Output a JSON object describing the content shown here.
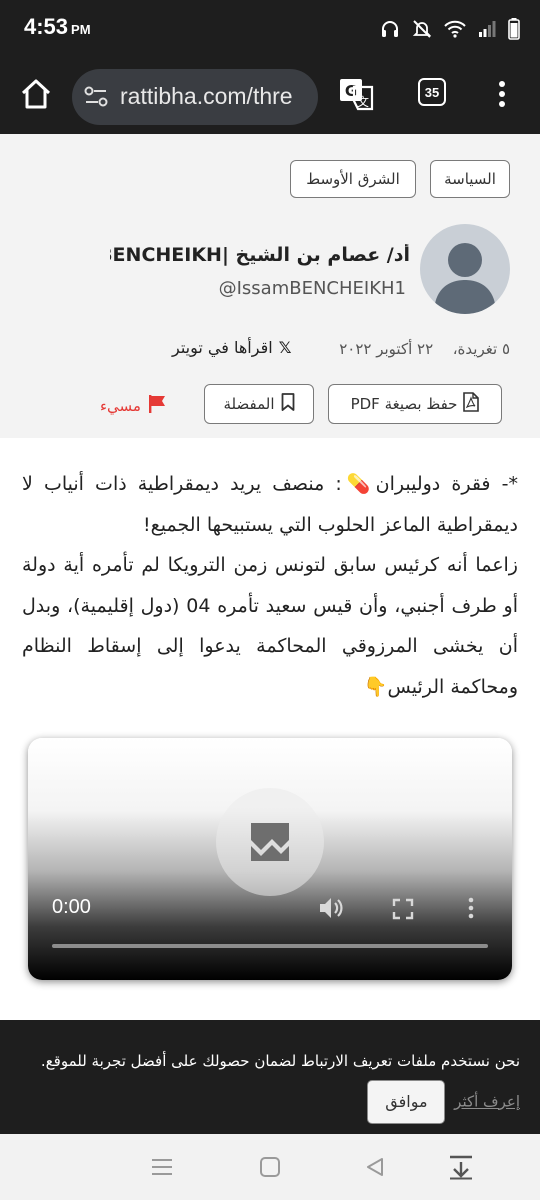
{
  "status_bar": {
    "time": "4:53",
    "ampm": "PM",
    "icons": [
      "headphones-icon",
      "mute-icon",
      "wifi-icon",
      "signal-icon",
      "battery-icon"
    ]
  },
  "browser": {
    "url": "rattibha.com/thre",
    "tab_count": "35",
    "icons": [
      "home-icon",
      "site-settings-icon",
      "translate-icon",
      "tabs-icon",
      "more-menu-icon"
    ]
  },
  "tags": [
    "السياسة",
    "الشرق الأوسط"
  ],
  "author": {
    "name": "أد/ عصام بن الشيخ |BENCHEIKH...",
    "handle": "@IssamBENCHEIKH1"
  },
  "meta": {
    "tweet_count": "٥ تغريدة،",
    "date": "٢٢ أكتوبر ٢٠٢٢",
    "read_on_x": "اقرأها في تويتر",
    "x_logo": "𝕏"
  },
  "actions": {
    "save_pdf": "حفظ بصيغة PDF",
    "favorites": "المفضلة",
    "report": "مسيء"
  },
  "article": {
    "text": "*- فقرة دوليبران💊: منصف يريد ديمقراطية ذات أنياب لا ديمقراطية الماعز الحلوب التي يستبيحها الجميع!\nزاعما أنه كرئيس سابق لتونس زمن الترويكا لم تأمره أية دولة أو طرف أجنبي، وأن قيس سعيد تأمره 04 (دول إقليمية)، وبدل أن يخشى المرزوقي المحاكمة يدعوا إلى إسقاط النظام ومحاكمة الرئيس👇"
  },
  "video": {
    "current_time": "0:00",
    "progress": 0
  },
  "cookie": {
    "text": "نحن نستخدم ملفات تعريف الارتباط لضمان حصولك على أفضل تجربة للموقع.",
    "learn_more": "إعرف أكثر",
    "agree": "موافق"
  },
  "colors": {
    "dark_bar": "#1e1e1e",
    "url_box": "#3a3d42",
    "report_red": "#e53935",
    "page_header_bg": "#f3f3f3"
  }
}
